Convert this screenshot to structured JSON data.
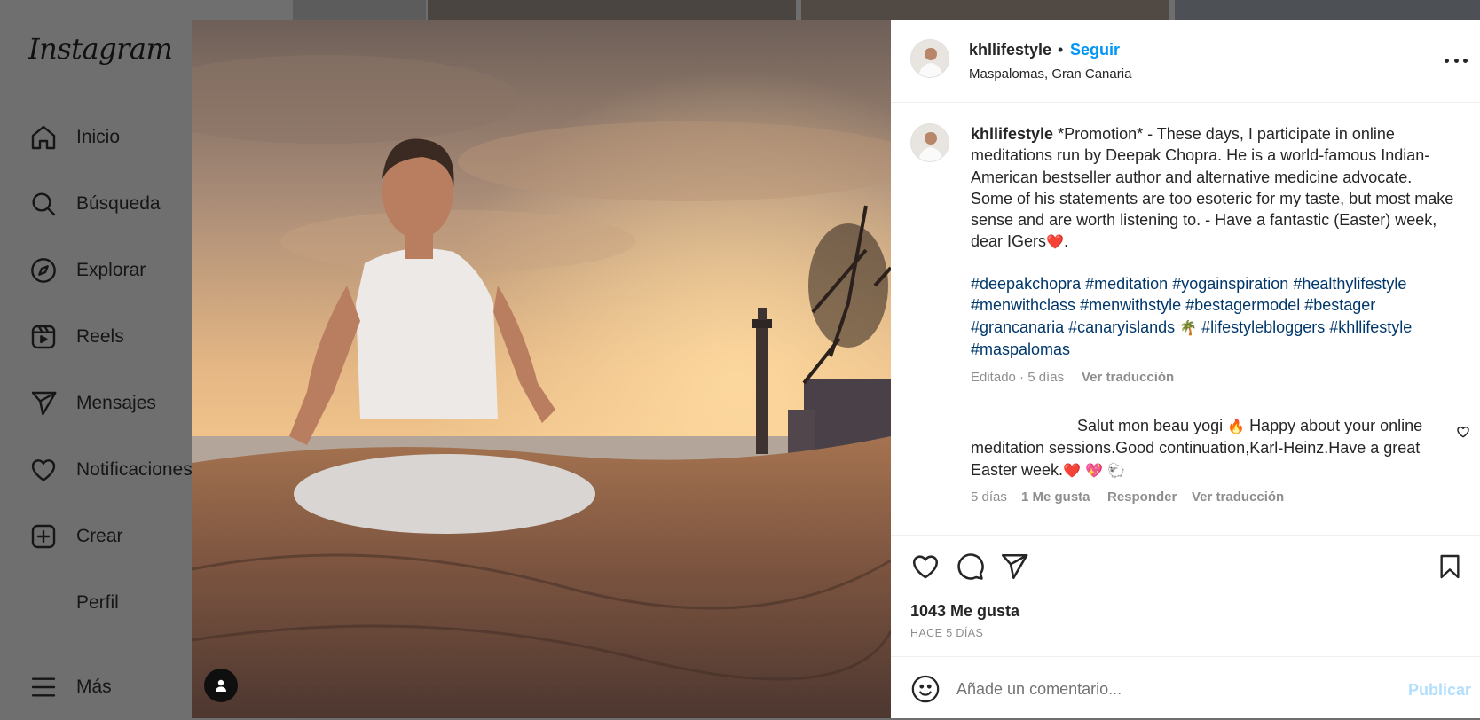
{
  "app": {
    "logo": "Instagram"
  },
  "sidebar": {
    "items": [
      {
        "label": "Inicio",
        "icon": "home-icon"
      },
      {
        "label": "Búsqueda",
        "icon": "search-icon"
      },
      {
        "label": "Explorar",
        "icon": "compass-icon"
      },
      {
        "label": "Reels",
        "icon": "reels-icon"
      },
      {
        "label": "Mensajes",
        "icon": "send-icon"
      },
      {
        "label": "Notificaciones",
        "icon": "heart-icon"
      },
      {
        "label": "Crear",
        "icon": "plus-square-icon"
      },
      {
        "label": "Perfil",
        "icon": "avatar"
      },
      {
        "label": "Más",
        "icon": "menu-icon"
      }
    ]
  },
  "post": {
    "username": "khllifestyle",
    "dot": "•",
    "follow_label": "Seguir",
    "location": "Maspalomas, Gran Canaria",
    "caption_text": "*Promotion* - These days, I participate in online meditations run by Deepak Chopra. He is a world-famous Indian-American bestseller author and alternative medicine advocate. Some of his statements are too esoteric for my taste, but most make sense and are worth listening to. - Have a fantastic (Easter) week, dear IGers",
    "caption_end": "❤️.",
    "hashtags": [
      "#deepakchopra",
      "#meditation",
      "#yogainspiration",
      "#healthylifestyle",
      "#menwithclass",
      "#menwithstyle",
      "#bestagermodel",
      "#bestager",
      "#grancanaria",
      "#canaryislands",
      "🌴",
      "#lifestylebloggers",
      "#khllifestyle",
      "#maspalomas"
    ],
    "edited": "Editado · 5 días",
    "see_translation": "Ver traducción",
    "likes": "1043 Me gusta",
    "posted_ago": "HACE 5 DÍAS"
  },
  "comment": {
    "text_1": "Salut mon beau yogi",
    "emoji_1": "🔥",
    "text_2": "Happy about your online meditation sessions.Good continuation,Karl-Heinz.Have a great Easter week.",
    "emoji_2": "❤️ 💖 🐑",
    "time": "5 días",
    "likes": "1 Me gusta",
    "reply": "Responder",
    "see_translation": "Ver traducción"
  },
  "comment_box": {
    "placeholder": "Añade un comentario...",
    "publish_label": "Publicar"
  },
  "colors": {
    "link_blue": "#0095f6",
    "hashtag_blue": "#00376b",
    "muted": "#8e8e8e",
    "publish_disabled": "#b2dffc",
    "overlay_gray": "#6f6f6f"
  }
}
